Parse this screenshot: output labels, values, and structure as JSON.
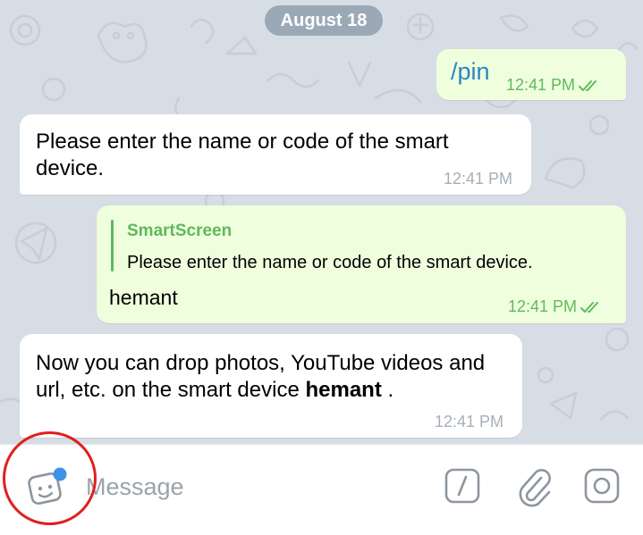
{
  "date_separator": "August 18",
  "messages": [
    {
      "direction": "out",
      "text": "/pin",
      "time": "12:41 PM",
      "status": "read"
    },
    {
      "direction": "in",
      "text": "Please enter the name or code of the smart device.",
      "time": "12:41 PM"
    },
    {
      "direction": "out",
      "reply_to": {
        "name": "SmartScreen",
        "text": "Please enter the name or code of the smart device."
      },
      "text": "hemant",
      "time": "12:41 PM",
      "status": "read"
    },
    {
      "direction": "in",
      "text_before": "Now you can drop photos, YouTube videos and url, etc. on the smart device ",
      "text_bold": "hemant",
      "text_after": " .",
      "time": "12:41 PM"
    }
  ],
  "input_bar": {
    "placeholder": "Message",
    "value": "",
    "icons": [
      "sticker-icon",
      "bot-command-icon",
      "paperclip-icon",
      "camera-icon"
    ]
  },
  "colors": {
    "chat_background": "#d7dde4",
    "outgoing_bubble": "#efffde",
    "incoming_bubble": "#ffffff",
    "accent_green": "#5fb95a",
    "link_blue": "#2b86c4",
    "highlight_red": "#e0201e"
  }
}
